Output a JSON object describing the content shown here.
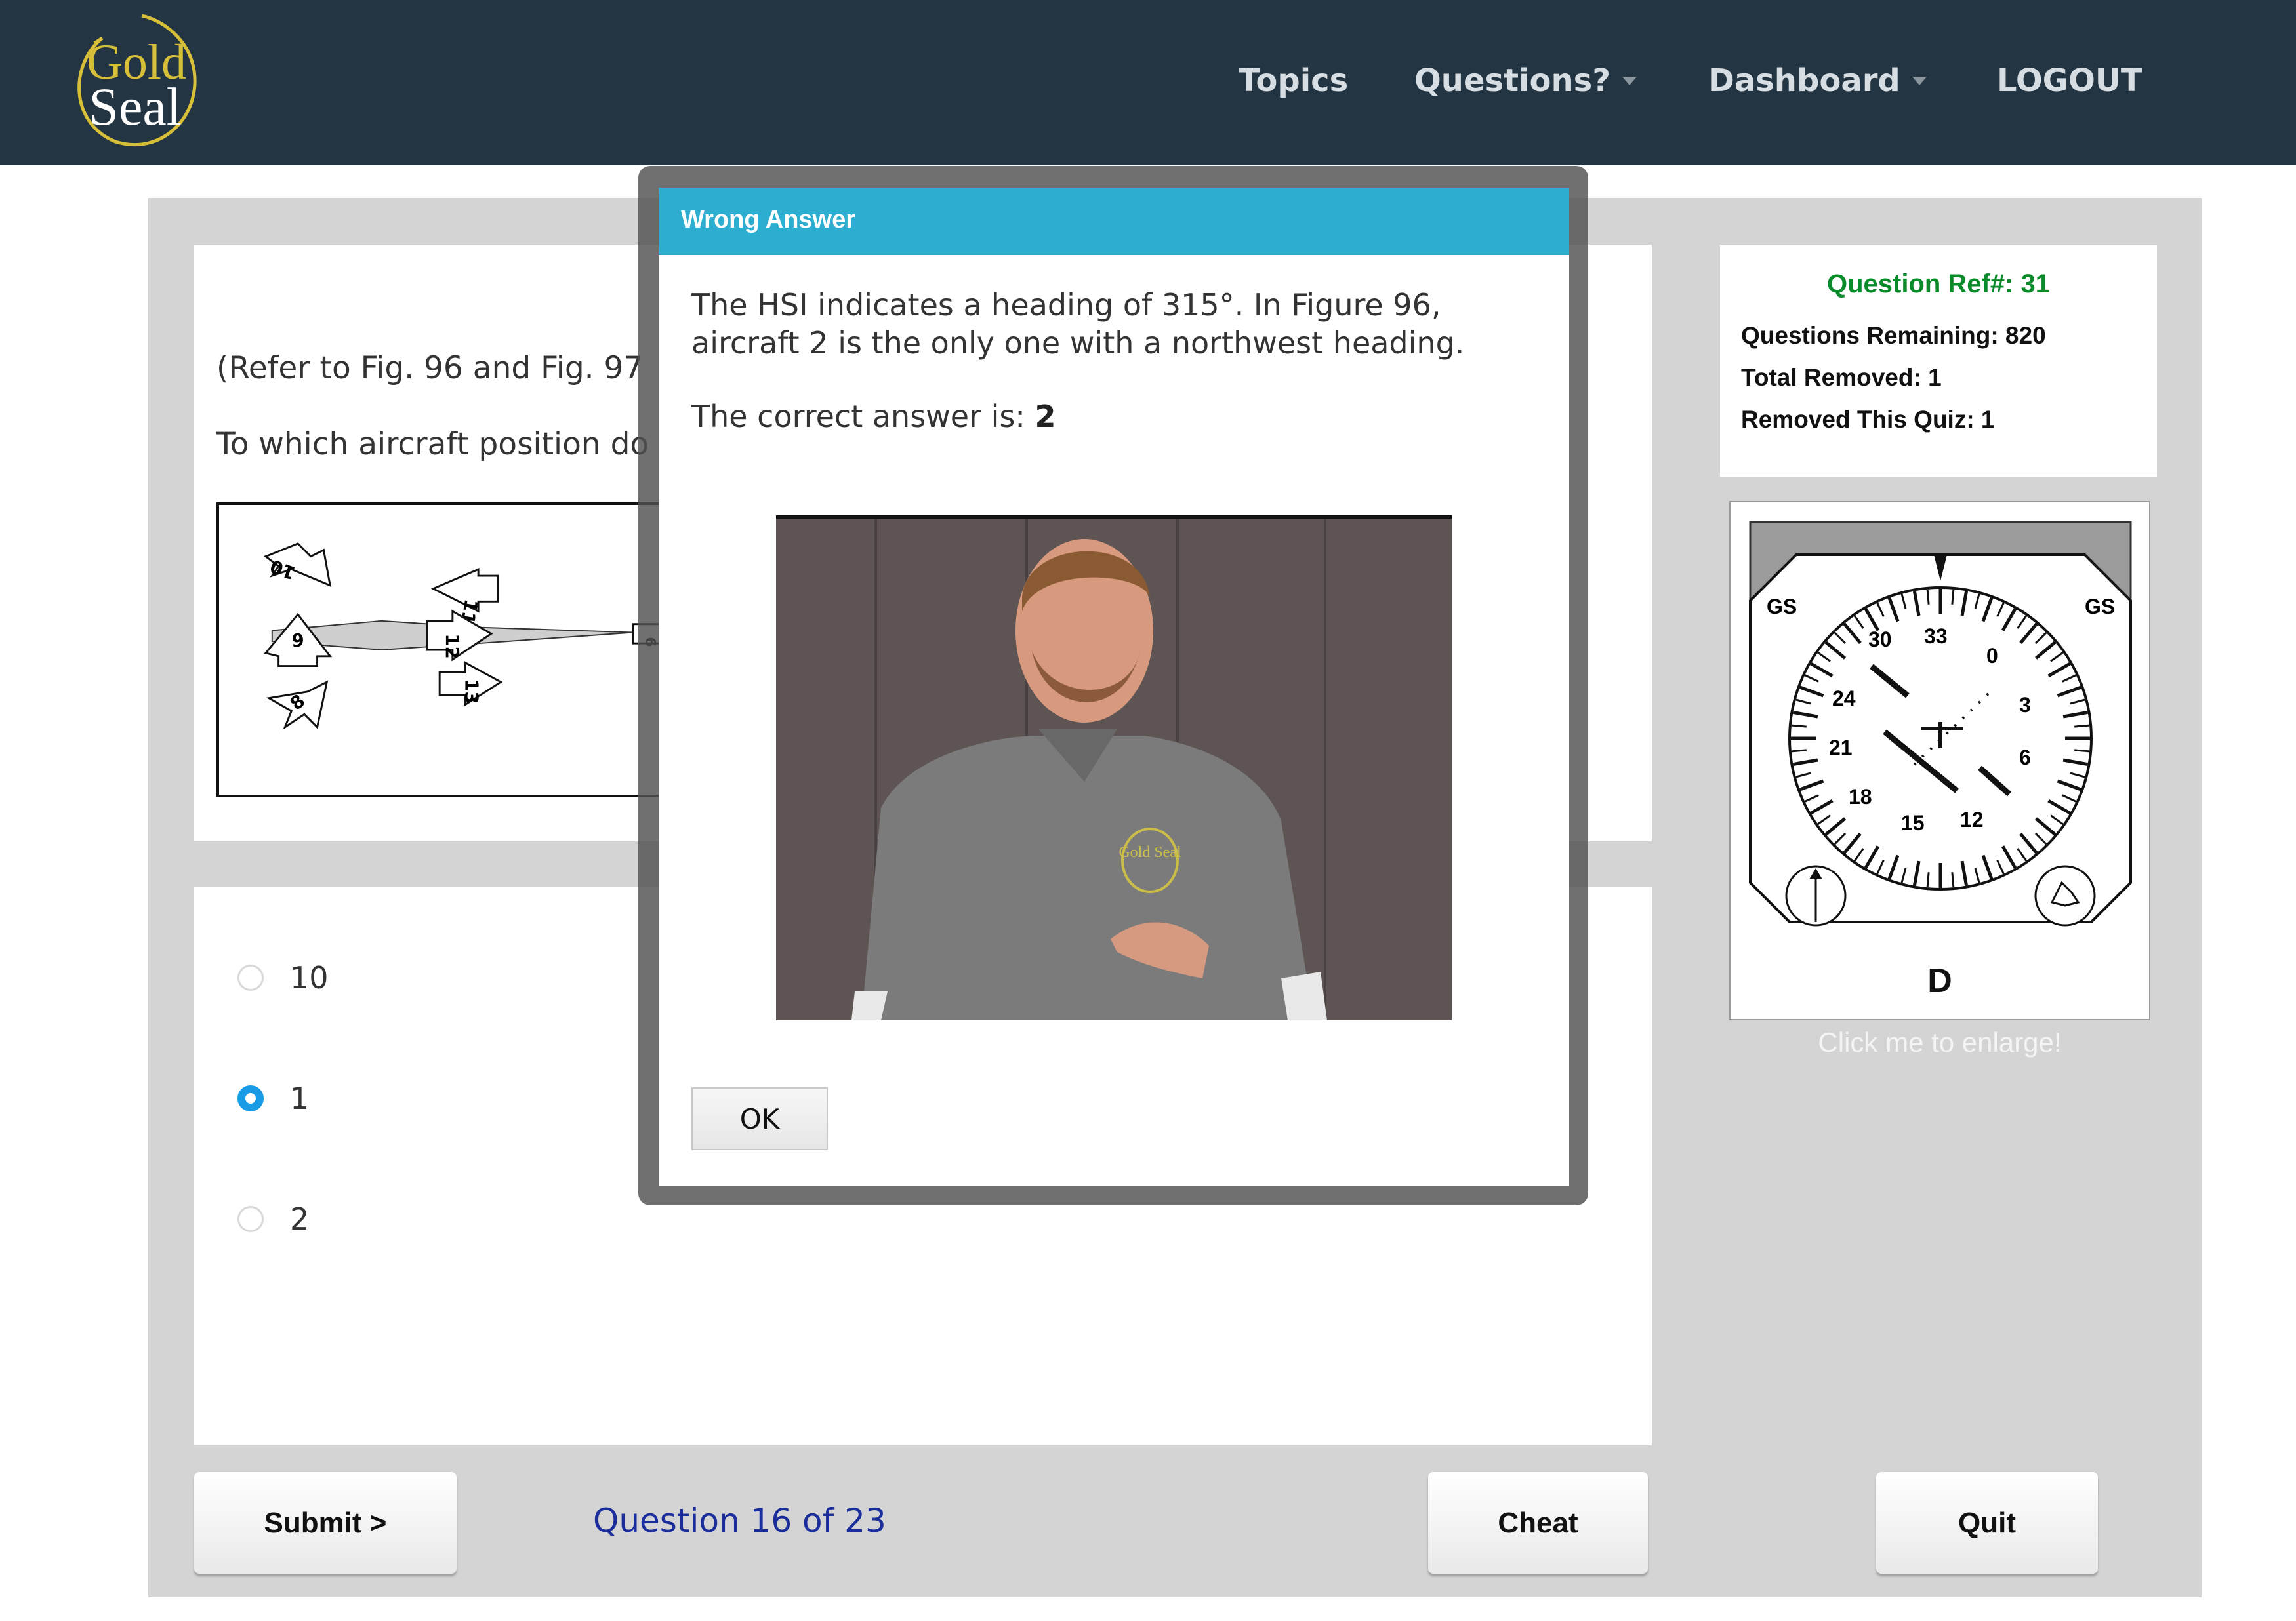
{
  "header": {
    "logo": {
      "line1": "Gold",
      "line2": "Seal"
    },
    "nav": [
      {
        "label": "Topics",
        "has_dropdown": false
      },
      {
        "label": "Questions?",
        "has_dropdown": true
      },
      {
        "label": "Dashboard",
        "has_dropdown": true
      },
      {
        "label": "LOGOUT",
        "has_dropdown": false
      }
    ]
  },
  "question": {
    "reference_text": "(Refer to Fig. 96 and Fig. 97",
    "prompt_text": "To which aircraft position do",
    "figure_96": {
      "aircraft_labels": [
        "10",
        "9",
        "8",
        "11",
        "12",
        "13",
        "6"
      ]
    }
  },
  "answers": {
    "options": [
      {
        "label": "10",
        "selected": false
      },
      {
        "label": "1",
        "selected": true
      },
      {
        "label": "2",
        "selected": false
      }
    ]
  },
  "stats": {
    "ref_label": "Question Ref#: 31",
    "questions_remaining": "Questions Remaining: 820",
    "total_removed": "Total Removed: 1",
    "removed_this_quiz": "Removed This Quiz: 1"
  },
  "hsi_figure": {
    "label": "D",
    "compass_labels": [
      "30",
      "33",
      "0",
      "3",
      "6",
      "12",
      "15",
      "18",
      "21",
      "24",
      "GS",
      "GS"
    ],
    "enlarge_hint": "Click me to enlarge!"
  },
  "footer": {
    "submit_label": "Submit >",
    "counter": "Question 16 of 23",
    "cheat_label": "Cheat",
    "quit_label": "Quit"
  },
  "modal": {
    "title": "Wrong Answer",
    "explanation": "The HSI indicates a heading of 315°. In Figure 96, aircraft 2 is the only one with a northwest heading.",
    "correct_prefix": "The correct answer is: ",
    "correct_value": "2",
    "video": {
      "shirt_logo": "Gold Seal"
    },
    "ok_label": "OK"
  },
  "colors": {
    "header_bg": "#233542",
    "modal_header": "#2daed0",
    "ref_green": "#0a8a2a",
    "counter_blue": "#1a2d9a",
    "radio_selected": "#1a9be6"
  }
}
